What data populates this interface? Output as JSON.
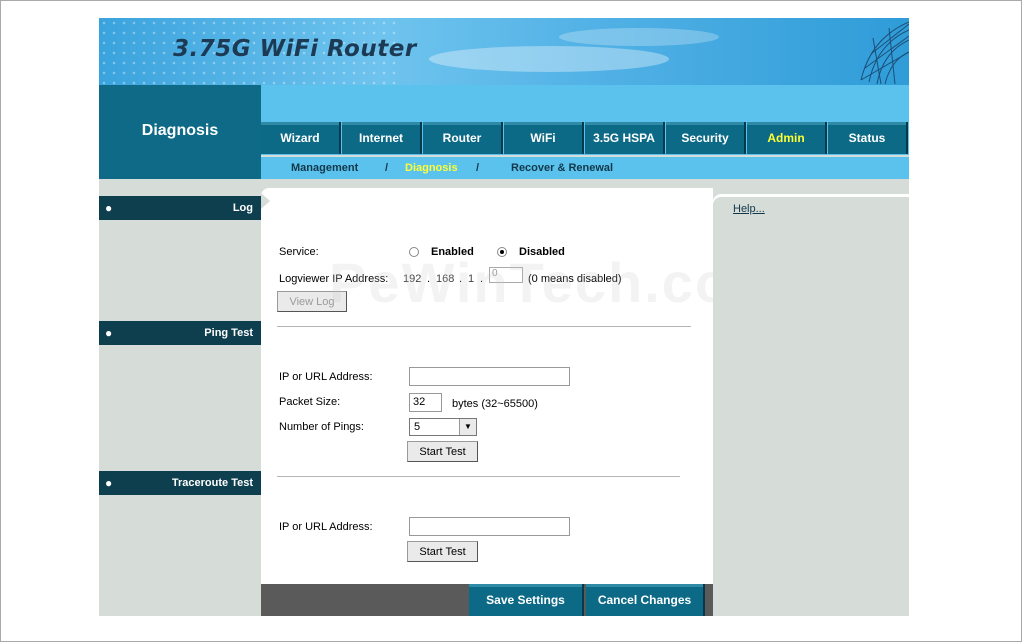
{
  "header": {
    "title": "3.75G WiFi Router"
  },
  "section": {
    "title": "Diagnosis"
  },
  "tabs": [
    {
      "label": "Wizard"
    },
    {
      "label": "Internet"
    },
    {
      "label": "Router"
    },
    {
      "label": "WiFi"
    },
    {
      "label": "3.5G HSPA"
    },
    {
      "label": "Security"
    },
    {
      "label": "Admin"
    },
    {
      "label": "Status"
    }
  ],
  "active_tab": "Admin",
  "subnav": {
    "items": [
      {
        "label": "Management"
      },
      {
        "label": "Diagnosis"
      },
      {
        "label": "Recover & Renewal"
      }
    ],
    "separator": "/",
    "active": "Diagnosis"
  },
  "sidebar": {
    "sections": [
      {
        "label": "Log",
        "bullet": "●"
      },
      {
        "label": "Ping Test",
        "bullet": "●"
      },
      {
        "label": "Traceroute Test",
        "bullet": "●"
      }
    ]
  },
  "help": {
    "link": "Help..."
  },
  "log": {
    "service_label": "Service:",
    "enabled_label": "Enabled",
    "disabled_label": "Disabled",
    "selected": "Disabled",
    "ip_label": "Logviewer IP Address:",
    "ip_parts": [
      "192",
      "168",
      "1"
    ],
    "ip_dot": ".",
    "ip_last_value": "0",
    "ip_hint": "(0 means disabled)",
    "view_log_button": "View Log"
  },
  "ping": {
    "ip_label": "IP or URL Address:",
    "ip_value": "",
    "packet_label": "Packet Size:",
    "packet_value": "32",
    "packet_hint": "bytes (32~65500)",
    "pings_label": "Number of Pings:",
    "pings_value": "5",
    "start_button": "Start Test"
  },
  "traceroute": {
    "ip_label": "IP or URL Address:",
    "ip_value": "",
    "start_button": "Start Test"
  },
  "footer": {
    "save_label": "Save Settings",
    "cancel_label": "Cancel Changes"
  },
  "watermark": "PeWinTech.com",
  "colors": {
    "tab_bg": "#0d6a86",
    "tab_active_text": "#ffff33",
    "nav_bg": "#5bc2ee",
    "sidebar_head": "#0e3f4f",
    "page_bg": "#d6dcd8"
  }
}
